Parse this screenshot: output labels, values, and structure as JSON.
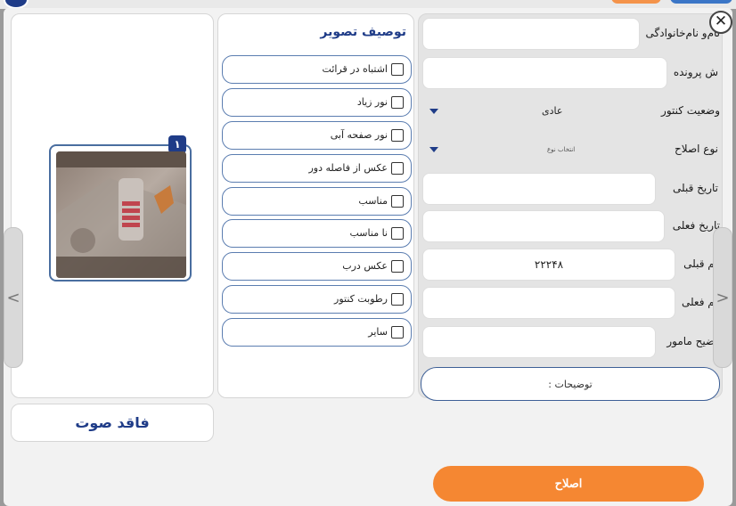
{
  "close_glyph": "✕",
  "audio": {
    "label": "فاقد صوت"
  },
  "thumbnail": {
    "badge": "۱"
  },
  "description": {
    "title": "توصیف تصویر",
    "items": [
      {
        "label": "اشتباه در قرائت"
      },
      {
        "label": "نور زیاد"
      },
      {
        "label": "نور صفحه آبی"
      },
      {
        "label": "عکس از فاصله دور"
      },
      {
        "label": "مناسب"
      },
      {
        "label": "نا مناسب"
      },
      {
        "label": "عکس درب"
      },
      {
        "label": "رطوبت کنتور"
      },
      {
        "label": "سایر"
      }
    ]
  },
  "form": {
    "name_label": "نام‌و نام‌خانوادگی",
    "file_label": "ش پرونده",
    "meter_status_label": "وضعیت کنتور",
    "meter_status_value": "عادی",
    "correction_type_label": "نوع اصلاح",
    "correction_type_value": "انتخاب نوع",
    "prev_date_label": "تاریخ قبلی",
    "curr_date_label": "تاریخ فعلی",
    "prev_number_label": "قم قبلی",
    "prev_number_value": "۲۲۲۴۸",
    "curr_number_label": "قم فعلی",
    "officer_note_label": "رضیح مامور",
    "notes_placeholder": "توضیحات :"
  },
  "nav": {
    "prev": "<",
    "next": ">"
  },
  "submit_label": "اصلاح",
  "colors": {
    "accent": "#1f3c88",
    "button": "#f58732",
    "border": "#5b7db0"
  },
  "icons": {
    "close": "close-icon",
    "dropdown": "caret-down-icon",
    "prev": "chevron-left-icon",
    "next": "chevron-right-icon"
  }
}
